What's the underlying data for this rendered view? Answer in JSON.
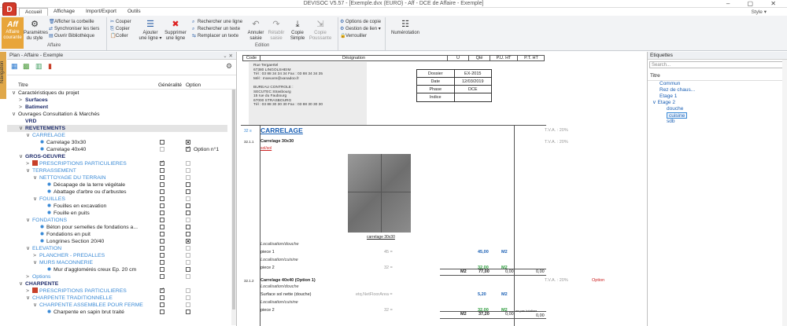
{
  "window": {
    "title": "DEVISOC V5.57 - [Exemple.dvx (EURO) - Aff - DCE de Affaire - Exemple]",
    "controls": "– ▢ ✕"
  },
  "menu": {
    "tabs": [
      "Accueil",
      "Affichage",
      "Import/Export",
      "Outils"
    ],
    "style_label": "Style"
  },
  "ribbon": {
    "affaire": {
      "btn_top": "Aff",
      "btn_label": "Affaire courante",
      "params_label": "Paramètres du style",
      "group": "Affaire",
      "small": [
        "Afficher la corbeille",
        "Synchroniser les tiers",
        "Ouvrir Bibliothèque"
      ]
    },
    "clipboard": [
      "Couper",
      "Copier",
      "Coller"
    ],
    "edition": {
      "add": "Ajouter une ligne",
      "delete": "Supprimer une ligne",
      "search": [
        "Rechercher une ligne",
        "Rechercher un texte",
        "Remplacer un texte"
      ],
      "undo": "Annuler saisie",
      "redo": "Rétablir saisie",
      "copy_simple": "Copie Simple",
      "copy_pousse": "Copie Poussante",
      "group": "Edition"
    },
    "options": [
      "Options de copie",
      "Gestion de lien",
      "Verrouiller"
    ],
    "numerotation": "Numérotation"
  },
  "left": {
    "vtab": "Navigation",
    "header": "Plan - Affaire - Exemple",
    "cols": {
      "titre": "Titre",
      "generalite": "Généralité",
      "option": "Option"
    },
    "rows": [
      {
        "label": "Caractéristiques du projet",
        "lvl": 0,
        "cls": "c-dark",
        "arrow": "∨",
        "g": "",
        "o": ""
      },
      {
        "label": "Surfaces",
        "lvl": 1,
        "cls": "c-navy",
        "arrow": ">",
        "g": "",
        "o": ""
      },
      {
        "label": "Batiment",
        "lvl": 1,
        "cls": "c-navy",
        "arrow": ">",
        "g": "",
        "o": ""
      },
      {
        "label": "Ouvrages Consultation & Marchés",
        "lvl": 0,
        "cls": "c-dark",
        "arrow": "∨",
        "g": "",
        "o": ""
      },
      {
        "label": "VRD",
        "lvl": 1,
        "cls": "c-navy",
        "arrow": "",
        "g": "",
        "o": ""
      },
      {
        "label": "REVETEMENTS",
        "lvl": 1,
        "cls": "c-navy",
        "arrow": "∨",
        "g": "",
        "o": "",
        "sel": true
      },
      {
        "label": "CARRELAGE",
        "lvl": 2,
        "cls": "c-lblue",
        "arrow": "∨",
        "g": "",
        "o": ""
      },
      {
        "label": "Carrelage 30x30",
        "lvl": 3,
        "cls": "c-dark",
        "arrow": "",
        "icon": "ball",
        "g": "cb",
        "o": "on"
      },
      {
        "label": "Carrelage 40x40",
        "lvl": 3,
        "cls": "c-dark",
        "arrow": "",
        "icon": "ball2",
        "g": "dis",
        "o": "chk",
        "otext": "Option n°1"
      },
      {
        "label": "GROS-OEUVRE",
        "lvl": 1,
        "cls": "c-navy",
        "arrow": "∨",
        "g": "",
        "o": ""
      },
      {
        "label": "PRESCRIPTIONS PARTICULIERES",
        "lvl": 2,
        "cls": "c-lblue",
        "arrow": ">",
        "icon": "book",
        "g": "chk",
        "o": "dis"
      },
      {
        "label": "TERRASSEMENT",
        "lvl": 2,
        "cls": "c-lblue",
        "arrow": "∨",
        "g": "cb",
        "o": "dis"
      },
      {
        "label": "NETTOYAGE DU TERRAIN",
        "lvl": 3,
        "cls": "c-lblue",
        "arrow": "∨",
        "g": "cb",
        "o": "dis"
      },
      {
        "label": "Décapage de la terre végétale",
        "lvl": 4,
        "cls": "c-dark",
        "arrow": "",
        "icon": "ball",
        "g": "cb",
        "o": "cb"
      },
      {
        "label": "Abattage d'arbre ou d'arbustes",
        "lvl": 4,
        "cls": "c-dark",
        "arrow": "",
        "icon": "ball",
        "g": "cb",
        "o": "cb"
      },
      {
        "label": "FOUILLES",
        "lvl": 3,
        "cls": "c-lblue",
        "arrow": "∨",
        "g": "cb",
        "o": "dis"
      },
      {
        "label": "Fouilles en excavation",
        "lvl": 4,
        "cls": "c-dark",
        "arrow": "",
        "icon": "ball",
        "g": "cb",
        "o": "cb"
      },
      {
        "label": "Fouille en puits",
        "lvl": 4,
        "cls": "c-dark",
        "arrow": "",
        "icon": "ball",
        "g": "cb",
        "o": "cb"
      },
      {
        "label": "FONDATIONS",
        "lvl": 2,
        "cls": "c-lblue",
        "arrow": "∨",
        "g": "cb",
        "o": "dis"
      },
      {
        "label": "Béton pour semelles de fondations a...",
        "lvl": 3,
        "cls": "c-dark",
        "arrow": "",
        "icon": "ball",
        "g": "cb",
        "o": "cb"
      },
      {
        "label": "Fondations en puit",
        "lvl": 3,
        "cls": "c-dark",
        "arrow": "",
        "icon": "ball",
        "g": "cb",
        "o": "cb"
      },
      {
        "label": "Longrines Section 20/40",
        "lvl": 3,
        "cls": "c-dark",
        "arrow": "",
        "icon": "ball",
        "g": "cb",
        "o": "on"
      },
      {
        "label": "ELEVATION",
        "lvl": 2,
        "cls": "c-lblue",
        "arrow": "∨",
        "g": "cb",
        "o": "dis"
      },
      {
        "label": "PLANCHER - PREDALLES",
        "lvl": 3,
        "cls": "c-lblue",
        "arrow": ">",
        "g": "cb",
        "o": "dis"
      },
      {
        "label": "MURS MACONNERIE",
        "lvl": 3,
        "cls": "c-lblue",
        "arrow": "∨",
        "g": "cb",
        "o": "dis"
      },
      {
        "label": "Mur d'agglomérés creux Ep. 20 cm",
        "lvl": 4,
        "cls": "c-dark",
        "arrow": "",
        "icon": "ball",
        "g": "cb",
        "o": "cb"
      },
      {
        "label": "Options",
        "lvl": 2,
        "cls": "c-lblue",
        "arrow": ">",
        "g": "cb",
        "o": "dis"
      },
      {
        "label": "CHARPENTE",
        "lvl": 1,
        "cls": "c-navy",
        "arrow": "∨",
        "g": "",
        "o": ""
      },
      {
        "label": "PRESCRIPTIONS PARTICULIERES",
        "lvl": 2,
        "cls": "c-lblue",
        "arrow": ">",
        "icon": "book",
        "g": "chk",
        "o": "dis"
      },
      {
        "label": "CHARPENTE TRADITIONNELLE",
        "lvl": 2,
        "cls": "c-lblue",
        "arrow": "∨",
        "g": "cb",
        "o": "dis"
      },
      {
        "label": "CHARPENTE ASSEMBLEE POUR FERME",
        "lvl": 3,
        "cls": "c-lblue",
        "arrow": "∨",
        "g": "cb",
        "o": "dis"
      },
      {
        "label": "Charpente en sapin brut traité",
        "lvl": 4,
        "cls": "c-dark",
        "arrow": "",
        "icon": "ball",
        "g": "cb",
        "o": "cb"
      }
    ]
  },
  "doc": {
    "cols": [
      "Code",
      "Désignation",
      "U",
      "Qté",
      "P.U. HT",
      "P.T. HT"
    ],
    "header_lines": [
      "Rue Tergaertel",
      "67380 LINGOLSHEIM",
      "Tél : 03 88 34 34 34   Fax : 03 88 34 34 35",
      "Mél : moeuvre@xanadoo.fr",
      "",
      "BUREAU CONTROLE :",
      "SECUTEC Strasbourg",
      "15 rue du Faubourg",
      "67000 STRASBOURG",
      "Tél : 03 88 30 30 30   Fax : 03 88 30 30 30"
    ],
    "info": [
      [
        "Dossier",
        "EX-2015"
      ],
      [
        "Date",
        "12/03/2019"
      ],
      [
        "Phase",
        "DCE"
      ],
      [
        "Indice",
        ""
      ]
    ],
    "sec_code": "32 ≡",
    "sec_title": "CARRELAGE",
    "tva1": "T.V.A. : 20%",
    "item1_code": "32.1.1",
    "item1_title": "Carrelage 30x30",
    "item1_sub": "sol/sol",
    "photo_caption": "carrelage 30x30",
    "item1_lines": [
      [
        "Localisation/douche",
        "",
        "",
        ""
      ],
      [
        "piece 1",
        "45 =",
        "45,00",
        "M2"
      ],
      [
        "Localisation/cuisine",
        "",
        "",
        ""
      ],
      [
        "piece 2",
        "32 =",
        "32,00",
        "M2"
      ]
    ],
    "item1_total": {
      "u": "M2",
      "q": "77,00",
      "pu": "0,00",
      "pt": "0,00"
    },
    "item2_code": "32.1.2",
    "item2_title": "Carrelage 40x40 (Option 1)",
    "item2_opt": "Option",
    "tva2": "T.V.A. : 20%",
    "item2_lines": [
      [
        "Localisation/douche",
        "",
        "",
        ""
      ],
      [
        "Surface sol nette (douche)",
        "etq.NetFloorArea =",
        "5,20",
        "M2"
      ],
      [
        "Localisation/cuisine",
        "",
        "",
        ""
      ],
      [
        "piece 2",
        "32 =",
        "32,00",
        "M2"
      ]
    ],
    "item2_total": {
      "u": "M2",
      "q": "37,20",
      "pu": "0,00",
      "pt": "0,00",
      "note": "ne pas totaliser"
    }
  },
  "right": {
    "header": "Etiquettes",
    "search_placeholder": "Search...",
    "title": "Titre",
    "tags": [
      {
        "label": "Commun",
        "lvl": 1
      },
      {
        "label": "Rez de chaus...",
        "lvl": 1
      },
      {
        "label": "Etage 1",
        "lvl": 1
      },
      {
        "label": "∨ Etage 2",
        "lvl": 0
      },
      {
        "label": "douche",
        "lvl": 2
      },
      {
        "label": "cuisine",
        "lvl": 2,
        "sel": true
      },
      {
        "label": "sdb",
        "lvl": 2
      }
    ]
  }
}
